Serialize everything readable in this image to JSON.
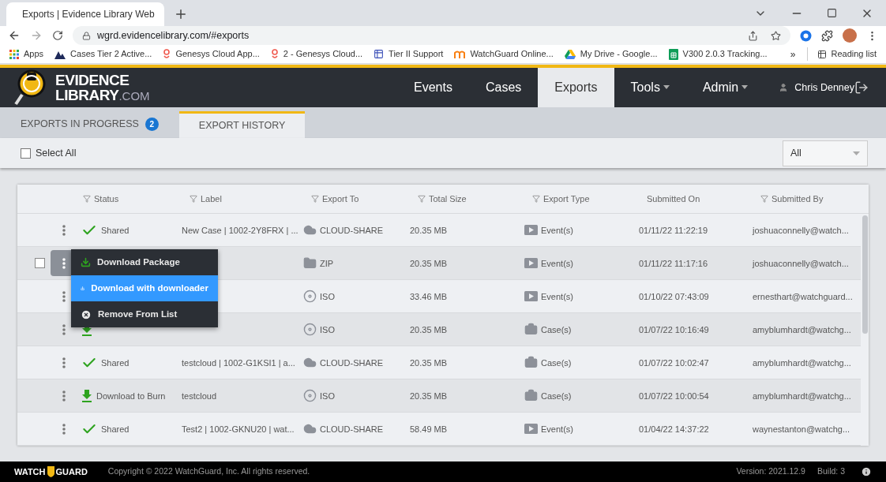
{
  "browser": {
    "tab_title": "Exports | Evidence Library Web",
    "url": "wgrd.evidencelibrary.com/#exports",
    "bookmarks": [
      {
        "label": "Apps",
        "kind": "apps"
      },
      {
        "label": "Cases Tier 2 Active...",
        "kind": "dynamics"
      },
      {
        "label": "Genesys Cloud App...",
        "kind": "genesys"
      },
      {
        "label": "2 - Genesys Cloud...",
        "kind": "genesys"
      },
      {
        "label": "Tier II Support",
        "kind": "form"
      },
      {
        "label": "WatchGuard Online...",
        "kind": "moodle"
      },
      {
        "label": "My Drive - Google...",
        "kind": "drive"
      },
      {
        "label": "V300 2.0.3 Tracking...",
        "kind": "sheets"
      }
    ],
    "more": "»",
    "reading_list": "Reading list"
  },
  "header": {
    "logo_main": "EVIDENCE",
    "logo_sub": "LIBRARY",
    "logo_suffix": ".COM",
    "nav": [
      {
        "label": "Events",
        "selected": false,
        "dropdown": false
      },
      {
        "label": "Cases",
        "selected": false,
        "dropdown": false
      },
      {
        "label": "Exports",
        "selected": true,
        "dropdown": false
      },
      {
        "label": "Tools",
        "selected": false,
        "dropdown": true
      },
      {
        "label": "Admin",
        "selected": false,
        "dropdown": true
      }
    ],
    "user": "Chris Denney"
  },
  "tabs": [
    {
      "label": "EXPORTS IN PROGRESS",
      "badge": "2",
      "selected": false
    },
    {
      "label": "EXPORT HISTORY",
      "selected": true
    }
  ],
  "toolbar": {
    "select_all": "Select All",
    "checked": false,
    "filter": "All"
  },
  "table": {
    "columns": [
      {
        "label": "Status",
        "filter": true
      },
      {
        "label": "Label",
        "filter": true
      },
      {
        "label": "Export To",
        "filter": true
      },
      {
        "label": "Total Size",
        "filter": true
      },
      {
        "label": "Export Type",
        "filter": true
      },
      {
        "label": "Submitted On",
        "filter": false
      },
      {
        "label": "Submitted By",
        "filter": true
      }
    ],
    "rows": [
      {
        "hovered": false,
        "status": {
          "text": "Shared",
          "kind": "shared"
        },
        "label": "New Case | 1002-2Y8FRX | ...",
        "export_to": {
          "text": "CLOUD-SHARE",
          "kind": "cloud"
        },
        "size": "20.35 MB",
        "export_type": {
          "text": "Event(s)",
          "kind": "event"
        },
        "submitted_on": "01/11/22 11:22:19",
        "submitted_by": "joshuaconnelly@watch..."
      },
      {
        "hovered": true,
        "checked": false,
        "export_to": {
          "text": "ZIP",
          "kind": "zip"
        },
        "size": "20.35 MB",
        "export_type": {
          "text": "Event(s)",
          "kind": "event"
        },
        "submitted_on": "01/11/22 11:17:16",
        "submitted_by": "joshuaconnelly@watch..."
      },
      {
        "hovered": false,
        "export_to": {
          "text": "ISO",
          "kind": "iso"
        },
        "size": "33.46 MB",
        "export_type": {
          "text": "Event(s)",
          "kind": "event"
        },
        "submitted_on": "01/10/22 07:43:09",
        "submitted_by": "ernesthart@watchguard..."
      },
      {
        "hovered": false,
        "status": {
          "kind": "burn"
        },
        "export_to": {
          "text": "ISO",
          "kind": "iso"
        },
        "size": "20.35 MB",
        "export_type": {
          "text": "Case(s)",
          "kind": "case"
        },
        "submitted_on": "01/07/22 10:16:49",
        "submitted_by": "amyblumhardt@watchg..."
      },
      {
        "hovered": false,
        "status": {
          "text": "Shared",
          "kind": "shared"
        },
        "label": "testcloud | 1002-G1KSI1 | a...",
        "export_to": {
          "text": "CLOUD-SHARE",
          "kind": "cloud"
        },
        "size": "20.35 MB",
        "export_type": {
          "text": "Case(s)",
          "kind": "case"
        },
        "submitted_on": "01/07/22 10:02:47",
        "submitted_by": "amyblumhardt@watchg..."
      },
      {
        "hovered": false,
        "status": {
          "text": "Download to Burn",
          "kind": "burn"
        },
        "label": "testcloud",
        "export_to": {
          "text": "ISO",
          "kind": "iso"
        },
        "size": "20.35 MB",
        "export_type": {
          "text": "Case(s)",
          "kind": "case"
        },
        "submitted_on": "01/07/22 10:00:54",
        "submitted_by": "amyblumhardt@watchg..."
      },
      {
        "hovered": false,
        "status": {
          "text": "Shared",
          "kind": "shared"
        },
        "label": "Test2 | 1002-GKNU20 | wat...",
        "export_to": {
          "text": "CLOUD-SHARE",
          "kind": "cloud"
        },
        "size": "58.49 MB",
        "export_type": {
          "text": "Event(s)",
          "kind": "event"
        },
        "submitted_on": "01/04/22 14:37:22",
        "submitted_by": "waynestanton@watchg..."
      }
    ]
  },
  "row_menu": {
    "items": [
      {
        "label": "Download Package",
        "kind": "download",
        "selected": false
      },
      {
        "label": "Download with downloader",
        "kind": "download",
        "selected": true
      },
      {
        "label": "Remove From List",
        "kind": "remove",
        "selected": false
      }
    ]
  },
  "footer": {
    "brand_left": "WATCH",
    "brand_right": "GUARD",
    "copyright": "Copyright © 2022 WatchGuard, Inc. All rights reserved.",
    "version": "Version: 2021.12.9",
    "build": "Build: 3"
  }
}
